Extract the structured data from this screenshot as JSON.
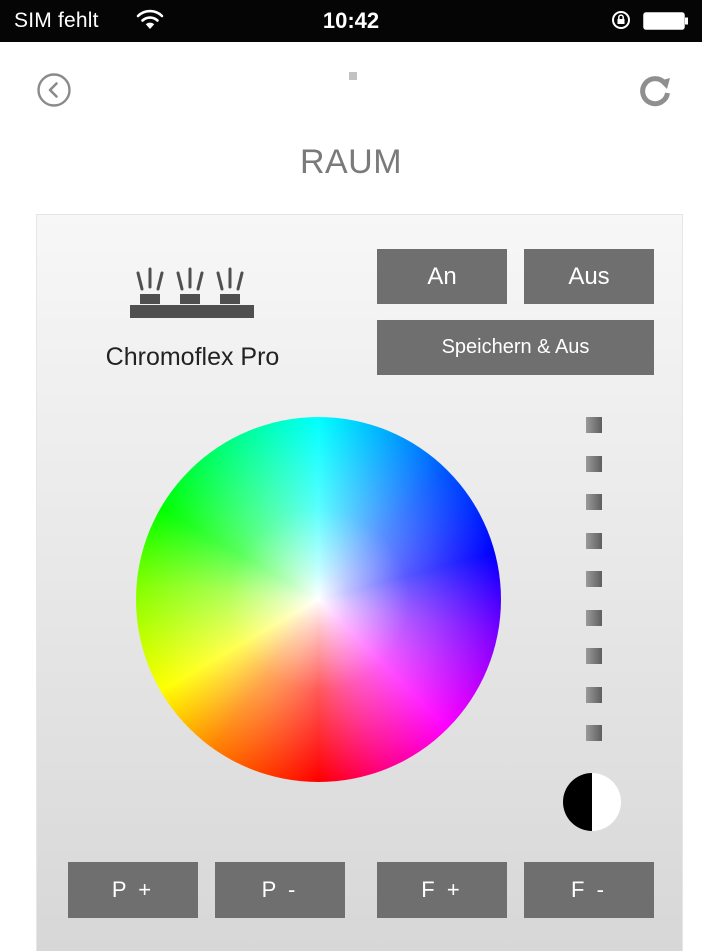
{
  "status_bar": {
    "carrier": "SIM fehlt",
    "time": "10:42",
    "wifi_icon": "wifi-icon",
    "lock_icon": "rotation-lock-icon",
    "battery_icon": "battery-icon"
  },
  "nav": {
    "back_icon": "back-chevron-icon",
    "refresh_icon": "refresh-icon"
  },
  "page_title": "RAUM",
  "device": {
    "icon": "led-controller-icon",
    "name": "Chromoflex Pro"
  },
  "buttons": {
    "on": "An",
    "off": "Aus",
    "save_off": "Speichern & Aus",
    "program_up": "P +",
    "program_down": "P -",
    "fade_up": "F +",
    "fade_down": "F -"
  },
  "color_wheel": {
    "icon": "color-wheel"
  },
  "brightness": {
    "steps": 9,
    "knob_icon": "brightness-knob-icon"
  },
  "colors": {
    "button_bg": "#6f6f6f",
    "title_color": "#7a7a7a",
    "status_bar_bg": "#050505"
  }
}
